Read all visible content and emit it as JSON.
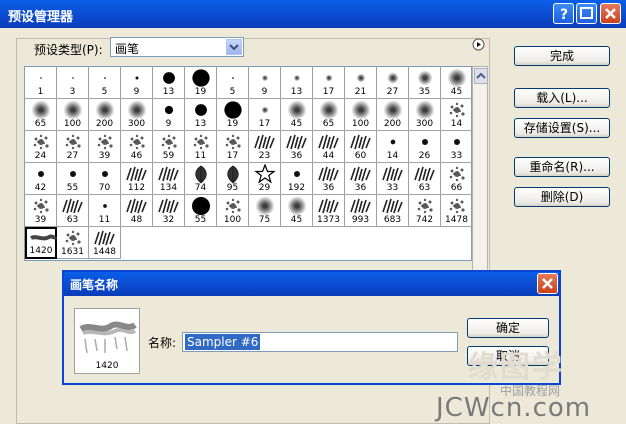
{
  "window": {
    "title": "预设管理器"
  },
  "preset_type": {
    "label": "预设类型(P):",
    "value": "画笔"
  },
  "buttons": {
    "done": "完成",
    "load": "载入(L)...",
    "save": "存储设置(S)...",
    "rename": "重命名(R)...",
    "delete": "删除(D)"
  },
  "brushes": [
    {
      "n": "1",
      "s": "dot"
    },
    {
      "n": "3",
      "s": "dot"
    },
    {
      "n": "5",
      "s": "dot"
    },
    {
      "n": "9",
      "s": "dot"
    },
    {
      "n": "13",
      "s": "hard"
    },
    {
      "n": "19",
      "s": "hard"
    },
    {
      "n": "5",
      "s": "dot"
    },
    {
      "n": "9",
      "s": "soft"
    },
    {
      "n": "13",
      "s": "soft"
    },
    {
      "n": "17",
      "s": "soft"
    },
    {
      "n": "21",
      "s": "soft"
    },
    {
      "n": "27",
      "s": "soft"
    },
    {
      "n": "35",
      "s": "soft"
    },
    {
      "n": "45",
      "s": "soft"
    },
    {
      "n": "65",
      "s": "soft"
    },
    {
      "n": "100",
      "s": "soft"
    },
    {
      "n": "200",
      "s": "soft"
    },
    {
      "n": "300",
      "s": "soft"
    },
    {
      "n": "9",
      "s": "hard"
    },
    {
      "n": "13",
      "s": "hard"
    },
    {
      "n": "19",
      "s": "hard"
    },
    {
      "n": "17",
      "s": "soft"
    },
    {
      "n": "45",
      "s": "soft"
    },
    {
      "n": "65",
      "s": "soft"
    },
    {
      "n": "100",
      "s": "soft"
    },
    {
      "n": "200",
      "s": "soft"
    },
    {
      "n": "300",
      "s": "soft"
    },
    {
      "n": "14",
      "s": "splat"
    },
    {
      "n": "24",
      "s": "splat"
    },
    {
      "n": "27",
      "s": "splat"
    },
    {
      "n": "39",
      "s": "splat"
    },
    {
      "n": "46",
      "s": "splat"
    },
    {
      "n": "59",
      "s": "splat"
    },
    {
      "n": "11",
      "s": "splat"
    },
    {
      "n": "17",
      "s": "splat"
    },
    {
      "n": "23",
      "s": "grass"
    },
    {
      "n": "36",
      "s": "grass"
    },
    {
      "n": "44",
      "s": "grass"
    },
    {
      "n": "60",
      "s": "grass"
    },
    {
      "n": "14",
      "s": "dot"
    },
    {
      "n": "26",
      "s": "dot"
    },
    {
      "n": "33",
      "s": "dot"
    },
    {
      "n": "42",
      "s": "dot"
    },
    {
      "n": "55",
      "s": "dot"
    },
    {
      "n": "70",
      "s": "dot"
    },
    {
      "n": "112",
      "s": "grass"
    },
    {
      "n": "134",
      "s": "grass"
    },
    {
      "n": "74",
      "s": "leaf"
    },
    {
      "n": "95",
      "s": "leaf"
    },
    {
      "n": "29",
      "s": "star"
    },
    {
      "n": "192",
      "s": "dot"
    },
    {
      "n": "36",
      "s": "grass"
    },
    {
      "n": "36",
      "s": "grass"
    },
    {
      "n": "33",
      "s": "grass"
    },
    {
      "n": "63",
      "s": "grass"
    },
    {
      "n": "66",
      "s": "splat"
    },
    {
      "n": "39",
      "s": "splat"
    },
    {
      "n": "63",
      "s": "grass"
    },
    {
      "n": "11",
      "s": "dot"
    },
    {
      "n": "48",
      "s": "grass"
    },
    {
      "n": "32",
      "s": "grass"
    },
    {
      "n": "55",
      "s": "hard"
    },
    {
      "n": "100",
      "s": "splat"
    },
    {
      "n": "75",
      "s": "soft"
    },
    {
      "n": "45",
      "s": "soft"
    },
    {
      "n": "1373",
      "s": "grass"
    },
    {
      "n": "993",
      "s": "grass"
    },
    {
      "n": "683",
      "s": "grass"
    },
    {
      "n": "742",
      "s": "splat"
    },
    {
      "n": "1478",
      "s": "splat"
    },
    {
      "n": "1420",
      "s": "brush",
      "sel": true
    },
    {
      "n": "1631",
      "s": "splat"
    },
    {
      "n": "1448",
      "s": "grass"
    }
  ],
  "rename_dialog": {
    "title": "画笔名称",
    "preview_number": "1420",
    "name_label": "名称:",
    "name_value": "Sampler #6",
    "ok": "确定",
    "cancel": "取消"
  },
  "watermark": {
    "line1": "缘图学",
    "line2": "JCWcn.com",
    "line3": "中国教程网"
  }
}
